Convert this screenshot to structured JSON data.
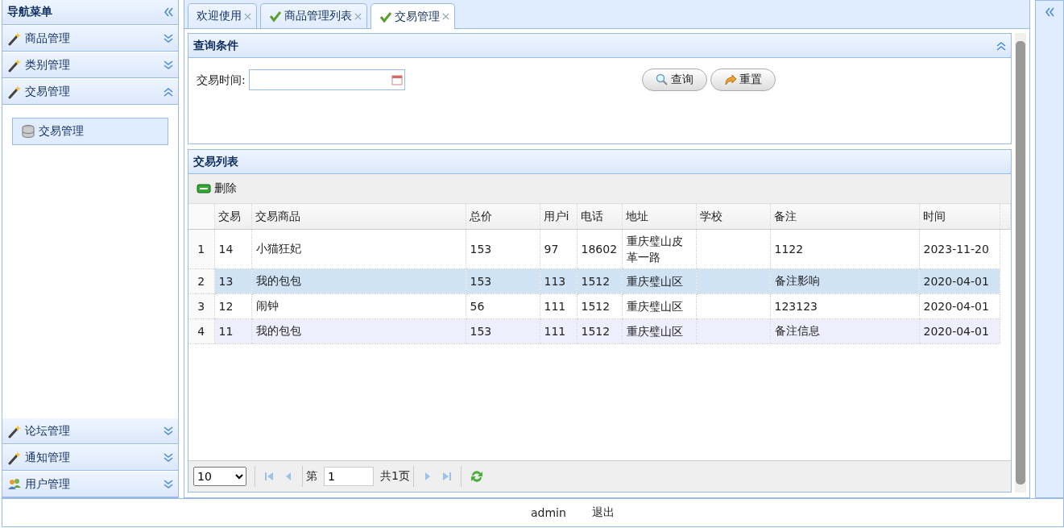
{
  "nav": {
    "title": "导航菜单",
    "groups": [
      {
        "label": "商品管理",
        "kind": "wand",
        "expanded": false
      },
      {
        "label": "类别管理",
        "kind": "wand",
        "expanded": false
      },
      {
        "label": "交易管理",
        "kind": "wand",
        "expanded": true,
        "children": [
          {
            "label": "交易管理",
            "selected": true
          }
        ]
      },
      {
        "label": "论坛管理",
        "kind": "wand",
        "expanded": false
      },
      {
        "label": "通知管理",
        "kind": "wand",
        "expanded": false
      },
      {
        "label": "用户管理",
        "kind": "users",
        "expanded": false
      }
    ]
  },
  "tabs": [
    {
      "label": "欢迎使用",
      "icon": false,
      "selected": false
    },
    {
      "label": "商品管理列表",
      "icon": true,
      "selected": false
    },
    {
      "label": "交易管理",
      "icon": true,
      "selected": true
    }
  ],
  "query": {
    "title": "查询条件",
    "field_label": "交易时间:",
    "buttons": [
      {
        "label": "查询",
        "kind": "search"
      },
      {
        "label": "重置",
        "kind": "reset"
      }
    ]
  },
  "grid": {
    "title": "交易列表",
    "toolbar": [
      "删除"
    ],
    "columns": [
      "交易",
      "交易商品",
      "总价",
      "用户i",
      "电话",
      "地址",
      "学校",
      "备注",
      "时间"
    ],
    "rows": [
      {
        "number": "1",
        "cells": [
          "14",
          "小猫狂妃",
          "153",
          "97",
          "18602",
          "重庆璧山皮革一路",
          "",
          "1122",
          "2023-11-20"
        ],
        "selected": false,
        "hovered": false
      },
      {
        "number": "2",
        "cells": [
          "13",
          "我的包包",
          "153",
          "113",
          "1512",
          "重庆璧山区",
          "",
          "备注影响",
          "2020-04-01"
        ],
        "selected": true,
        "hovered": false
      },
      {
        "number": "3",
        "cells": [
          "12",
          "闹钟",
          "56",
          "111",
          "1512",
          "重庆璧山区",
          "",
          "123123",
          "2020-04-01"
        ],
        "selected": false,
        "hovered": false
      },
      {
        "number": "4",
        "cells": [
          "11",
          "我的包包",
          "153",
          "111",
          "1512",
          "重庆璧山区",
          "",
          "备注信息",
          "2020-04-01"
        ],
        "selected": false,
        "hovered": true
      }
    ]
  },
  "pager": {
    "page_size": "10",
    "page_prefix": "第",
    "page": "1",
    "page_suffix": "共1页"
  },
  "footer": {
    "user": "admin",
    "logout": "退出"
  }
}
